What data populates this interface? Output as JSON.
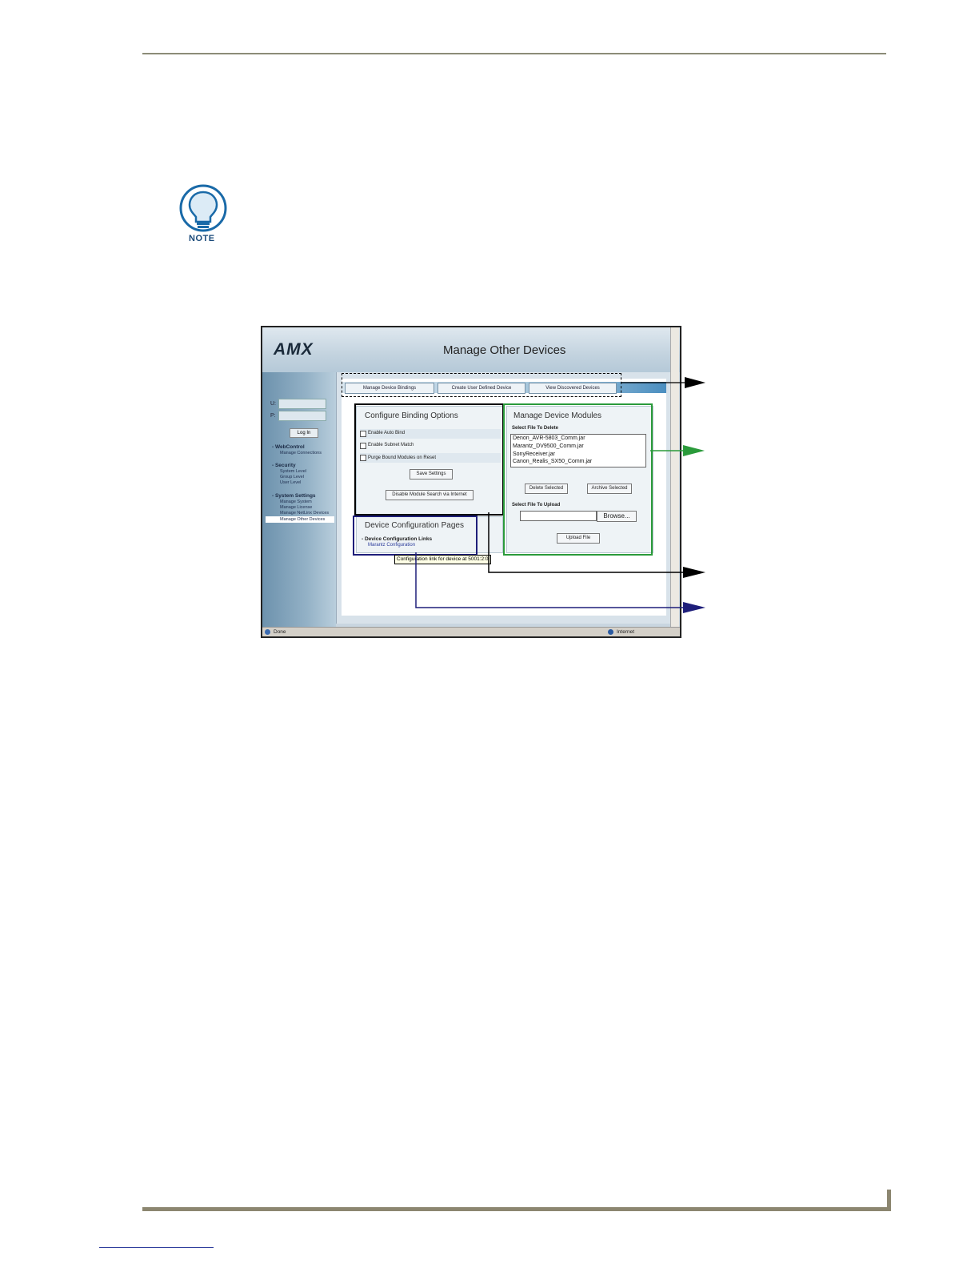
{
  "note": {
    "label": "NOTE"
  },
  "screen": {
    "logo": "AMX",
    "title": "Manage Other Devices",
    "login": {
      "user_label": "U:",
      "pass_label": "P:",
      "button": "Log In"
    },
    "nav": [
      {
        "heading": "- WebControl",
        "items": [
          "Manage Connections"
        ]
      },
      {
        "heading": "- Security",
        "items": [
          "System Level",
          "Group Level",
          "User Level"
        ]
      },
      {
        "heading": "- System Settings",
        "items": [
          "Manage System",
          "Manage License",
          "Manage NetLinx Devices",
          "Manage Other Devices"
        ]
      }
    ],
    "tabs": [
      "Manage Device Bindings",
      "Create User Defined Device",
      "View Discovered Devices"
    ],
    "binding": {
      "title": "Configure Binding Options",
      "options": [
        "Enable Auto Bind",
        "Enable Subnet Match",
        "Purge Bound Modules on Reset"
      ],
      "save": "Save Settings",
      "disable": "Disable Module Search via Internet"
    },
    "config": {
      "title": "Device Configuration Pages",
      "links_heading": "- Device Configuration Links",
      "link": "Marantz Configuration",
      "tooltip": "Configuration link for device at 5001:2:0"
    },
    "modules": {
      "title": "Manage Device Modules",
      "delete_label": "Select File To Delete",
      "files": [
        "Denon_AVR-5803_Comm.jar",
        "Marantz_DV9500_Comm.jar",
        "SonyReceiver.jar",
        "Canon_Realis_SX50_Comm.jar"
      ],
      "delete_btn": "Delete Selected",
      "archive_btn": "Archive Selected",
      "upload_label": "Select File To Upload",
      "browse_btn": "Browse...",
      "upload_btn": "Upload File"
    },
    "status": {
      "left": "Done",
      "right": "Internet"
    }
  },
  "colors": {
    "callout_green": "#2a9a3a",
    "callout_navy": "#1e1e7a",
    "rule": "#8c8670"
  }
}
